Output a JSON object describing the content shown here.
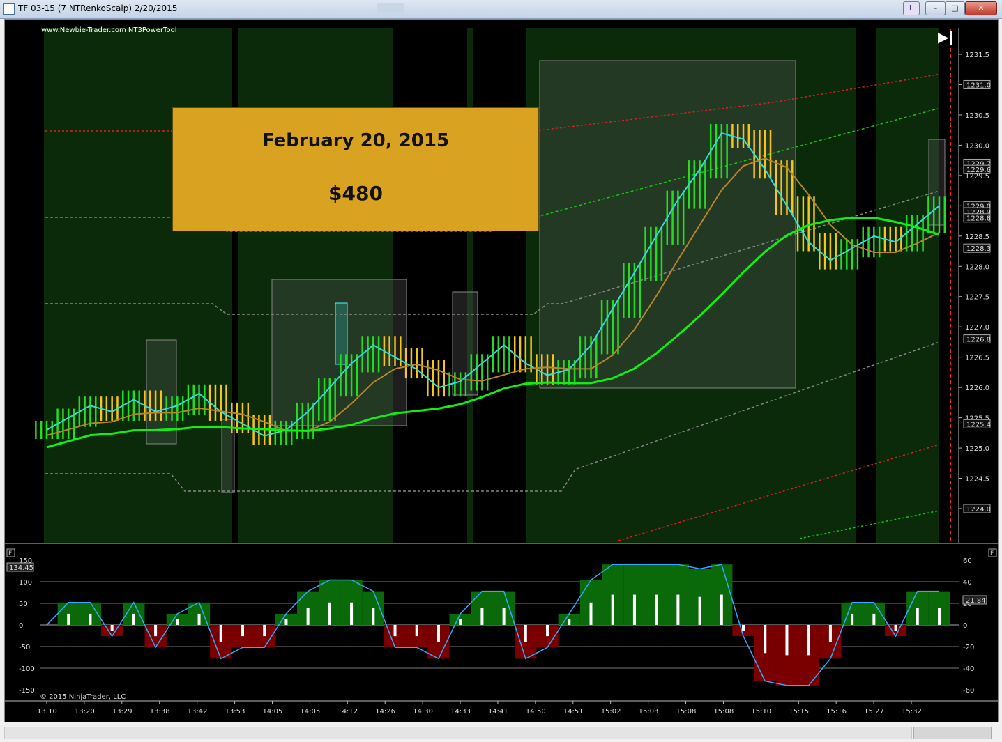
{
  "window": {
    "title": "TF 03-15 (7 NTRenkoScalp)  2/20/2015",
    "buttons": {
      "link": "L",
      "minimize": "–",
      "maximize": "□",
      "close": "✕"
    }
  },
  "chart": {
    "watermark": "www.Newbie-Trader.com NT3PowerTool",
    "copyright": "© 2015 NinjaTrader, LLC",
    "panel_flags": [
      "F",
      "F"
    ],
    "scroll_end_icon": "▶|"
  },
  "banner": {
    "date": "February 20, 2015",
    "amount": "$480"
  },
  "chart_data": {
    "type": "candlestick",
    "price_axis": {
      "ticks": [
        "1231.5",
        "1231.0",
        "1230.5",
        "1230.0",
        "1229.5",
        "1229.0",
        "1228.5",
        "1228.0",
        "1227.5",
        "1227.0",
        "1226.5",
        "1226.0",
        "1225.5",
        "1225.0",
        "1224.5",
        "1224.0"
      ],
      "tags": [
        "1231.0",
        "1229.7",
        "1229.6",
        "1229.0",
        "1228.9",
        "1228.8",
        "1228.3",
        "1226.8",
        "1225.4",
        "1224.0"
      ],
      "ylim": [
        1223.5,
        1231.8
      ]
    },
    "time_labels": [
      "13:10",
      "13:20",
      "13:29",
      "13:38",
      "13:42",
      "13:53",
      "14:05",
      "14:05",
      "14:12",
      "14:26",
      "14:30",
      "14:33",
      "14:41",
      "14:50",
      "14:51",
      "15:02",
      "15:03",
      "15:08",
      "15:08",
      "15:10",
      "15:15",
      "15:16",
      "15:27",
      "15:32"
    ],
    "oscillator": {
      "left_ticks": [
        "150",
        "100",
        "50",
        "0",
        "-50",
        "-100",
        "-150"
      ],
      "right_ticks": [
        "60",
        "40",
        "20",
        "0",
        "-20",
        "-40",
        "-60"
      ],
      "left_tag": "134.45",
      "right_tag": "21.84"
    },
    "close_series": [
      1225.3,
      1225.5,
      1225.7,
      1225.6,
      1225.8,
      1225.6,
      1225.7,
      1225.9,
      1225.6,
      1225.4,
      1225.2,
      1225.3,
      1225.6,
      1226.0,
      1226.4,
      1226.7,
      1226.5,
      1226.3,
      1226.0,
      1226.1,
      1226.4,
      1226.7,
      1226.4,
      1226.2,
      1226.3,
      1226.7,
      1227.3,
      1227.9,
      1228.5,
      1229.1,
      1229.6,
      1230.2,
      1230.1,
      1229.6,
      1229.0,
      1228.4,
      1228.1,
      1228.3,
      1228.5,
      1228.4,
      1228.7,
      1229.0
    ]
  }
}
